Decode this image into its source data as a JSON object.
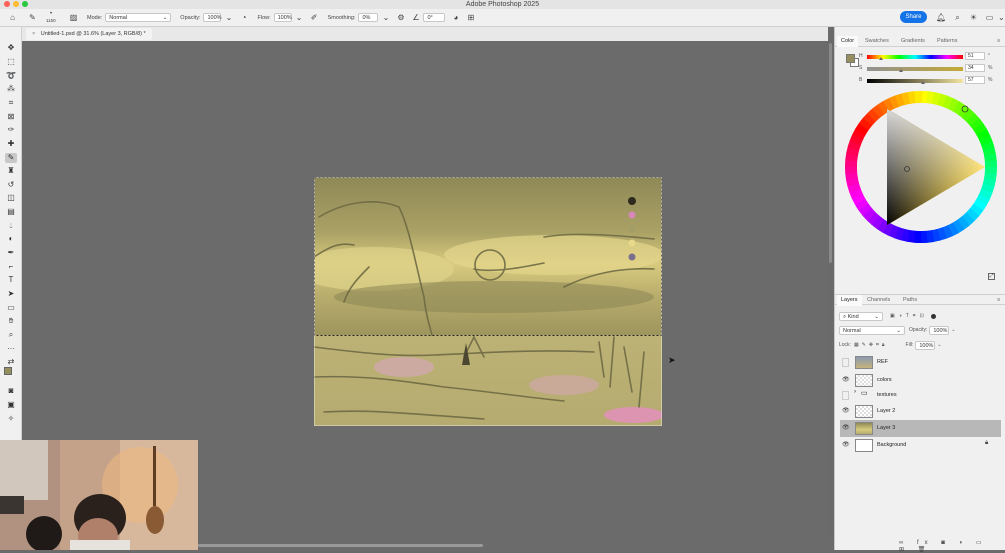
{
  "window": {
    "title": "Adobe Photoshop 2025"
  },
  "options_bar": {
    "brush_size": "1150",
    "mode_label": "Mode:",
    "mode_value": "Normal",
    "opacity_label": "Opacity:",
    "opacity_value": "100%",
    "flow_label": "Flow:",
    "flow_value": "100%",
    "smoothing_label": "Smoothing:",
    "smoothing_value": "0%",
    "angle_value": "0°",
    "share_label": "Share"
  },
  "document": {
    "tab_title": "Untitled-1.psd @ 31.6% (Layer 3, RGB/8) *"
  },
  "color_panel": {
    "tabs": [
      "Color",
      "Swatches",
      "Gradients",
      "Patterns"
    ],
    "sliders": [
      {
        "label": "H",
        "value": "51",
        "unit": "°",
        "level": 0.14
      },
      {
        "label": "S",
        "value": "34",
        "unit": "%",
        "level": 0.34
      },
      {
        "label": "B",
        "value": "57",
        "unit": "%",
        "level": 0.57
      }
    ],
    "foreground_color": "#958f5e",
    "background_color": "#ffffff"
  },
  "layers_panel": {
    "tabs": [
      "Layers",
      "Channels",
      "Paths"
    ],
    "filter_kind": "Kind",
    "blend_mode": "Normal",
    "opacity_label": "Opacity:",
    "opacity_value": "100%",
    "lock_label": "Lock:",
    "fill_label": "Fill:",
    "fill_value": "100%",
    "layers": [
      {
        "name": "REF",
        "visible": false,
        "type": "image"
      },
      {
        "name": "colors",
        "visible": true,
        "type": "pixel"
      },
      {
        "name": "textures",
        "visible": false,
        "type": "group"
      },
      {
        "name": "Layer 2",
        "visible": true,
        "type": "pixel"
      },
      {
        "name": "Layer 3",
        "visible": true,
        "type": "painting",
        "selected": true
      },
      {
        "name": "Background",
        "visible": true,
        "type": "background",
        "locked": true
      }
    ]
  },
  "accent_color": "#1473e6"
}
